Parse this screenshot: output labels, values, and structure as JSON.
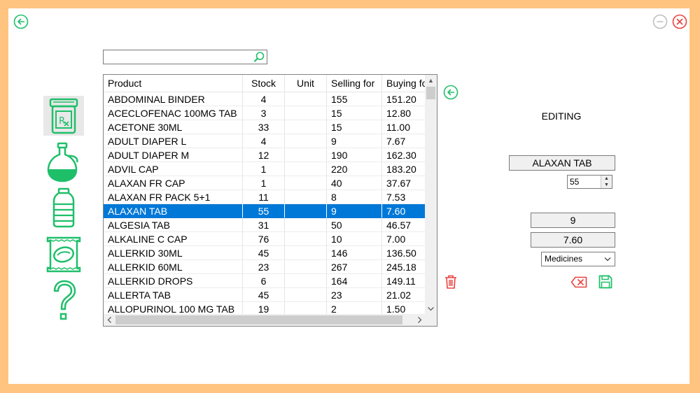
{
  "window": {
    "back_icon": "back-arrow-icon",
    "minimize_icon": "minimize-icon",
    "close_icon": "close-icon"
  },
  "sidebar": {
    "items": [
      {
        "icon": "prescription-bottle-icon",
        "selected": true
      },
      {
        "icon": "oil-bottle-icon",
        "selected": false
      },
      {
        "icon": "water-bottle-icon",
        "selected": false
      },
      {
        "icon": "snack-bag-icon",
        "selected": false
      },
      {
        "icon": "question-mark-icon",
        "selected": false
      }
    ]
  },
  "search": {
    "value": "",
    "placeholder": ""
  },
  "table": {
    "columns": [
      "Product",
      "Stock",
      "Unit",
      "Selling for",
      "Buying fo"
    ],
    "rows": [
      [
        "ABDOMINAL BINDER",
        "4",
        "",
        "155",
        "151.20"
      ],
      [
        "ACECLOFENAC 100MG TAB",
        "3",
        "",
        "15",
        "12.80"
      ],
      [
        "ACETONE 30ML",
        "33",
        "",
        "15",
        "11.00"
      ],
      [
        "ADULT DIAPER L",
        "4",
        "",
        "9",
        "7.67"
      ],
      [
        "ADULT DIAPER M",
        "12",
        "",
        "190",
        "162.30"
      ],
      [
        "ADVIL CAP",
        "1",
        "",
        "220",
        "183.20"
      ],
      [
        "ALAXAN FR CAP",
        "1",
        "",
        "40",
        "37.67"
      ],
      [
        "ALAXAN FR PACK 5+1",
        "11",
        "",
        "8",
        "7.53"
      ],
      [
        "ALAXAN TAB",
        "55",
        "",
        "9",
        "7.60"
      ],
      [
        "ALGESIA TAB",
        "31",
        "",
        "50",
        "46.57"
      ],
      [
        "ALKALINE C CAP",
        "76",
        "",
        "10",
        "7.00"
      ],
      [
        "ALLERKID 30ML",
        "45",
        "",
        "146",
        "136.50"
      ],
      [
        "ALLERKID 60ML",
        "23",
        "",
        "267",
        "245.18"
      ],
      [
        "ALLERKID DROPS",
        "6",
        "",
        "164",
        "149.11"
      ],
      [
        "ALLERTA TAB",
        "45",
        "",
        "23",
        "21.02"
      ],
      [
        "ALLOPURINOL 100 MG TAB",
        "19",
        "",
        "2",
        "1.50"
      ]
    ],
    "selected_row": 8
  },
  "editing": {
    "title": "EDITING",
    "name": "ALAXAN TAB",
    "stock": "55",
    "selling": "9",
    "buying": "7.60",
    "category": "Medicines"
  },
  "colors": {
    "frame": "#ffc47f",
    "accent_green": "#1fbf6a",
    "danger_red": "#e8423f",
    "selection_blue": "#0078d7"
  }
}
